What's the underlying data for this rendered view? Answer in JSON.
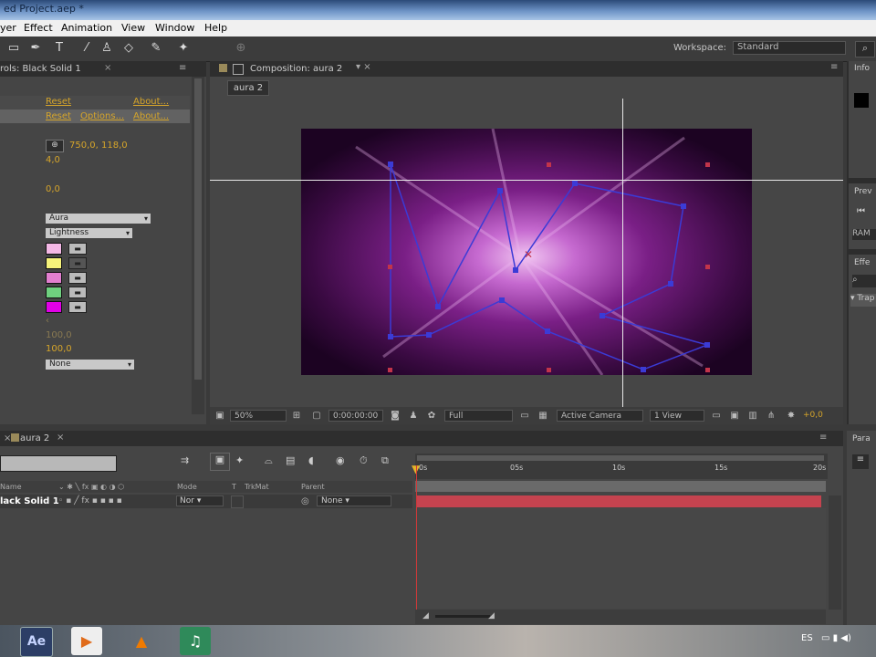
{
  "window": {
    "title": "ed Project.aep *"
  },
  "menu": [
    "yer",
    "Effect",
    "Animation",
    "View",
    "Window",
    "Help"
  ],
  "workspace": {
    "label": "Workspace:",
    "value": "Standard"
  },
  "effects_panel": {
    "tab_title": "rols: Black Solid 1",
    "rows": {
      "reset_1": "Reset",
      "about_1": "About...",
      "reset_2": "Reset",
      "options_2": "Options...",
      "about_2": "About...",
      "position": "750,0, 118,0",
      "v1": "4,0",
      "v2": "0,0",
      "select1": "Aura",
      "select2": "Lightness",
      "v3": "100,0",
      "v4": "100,0",
      "v5": "None"
    },
    "colors": [
      "#f4b8e6",
      "#f5f27a",
      "#e27fcf",
      "#6fd07f",
      "#e100e6"
    ]
  },
  "composition": {
    "tab_title": "Composition: aura 2",
    "breadcrumb": "aura 2",
    "footer": {
      "zoom": "50%",
      "timecode": "0:00:00:00",
      "resolution": "Full",
      "camera": "Active Camera",
      "views": "1 View",
      "exposure": "+0,0"
    }
  },
  "right_panels": {
    "info": "Info",
    "preview": "Prev",
    "preview_btn": "RAM",
    "effects": "Effe",
    "item": "Trap",
    "para": "Para"
  },
  "timeline": {
    "tab_title": "aura 2",
    "headers": {
      "name": "Name",
      "mode": "Mode",
      "t": "T",
      "trkmat": "TrkMat",
      "parent": "Parent"
    },
    "layer": {
      "name": "lack Solid 1",
      "mode": "Nor",
      "parent": "None"
    },
    "ruler": [
      "0s",
      "05s",
      "10s",
      "15s",
      "20s"
    ]
  },
  "taskbar": {
    "lang": "ES"
  },
  "colors": {
    "accent_link": "#d6a52a",
    "layer_bar": "#c5434f",
    "mask_path": "#3b3bd6"
  }
}
